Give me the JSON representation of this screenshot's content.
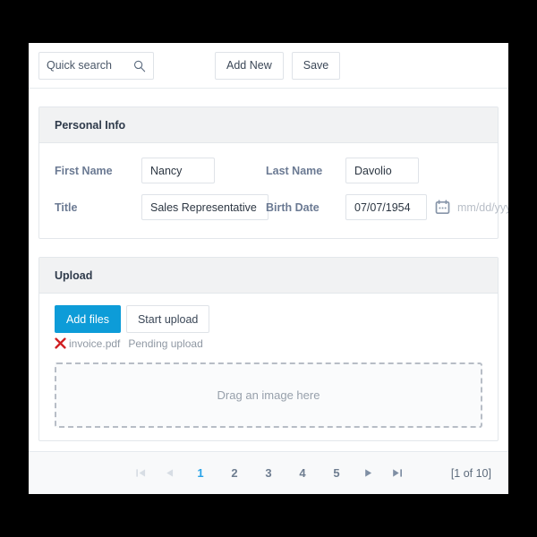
{
  "toolbar": {
    "search": {
      "value": "",
      "placeholder": "Quick search",
      "icon": "search-icon"
    },
    "buttons": [
      {
        "label": "Add New",
        "name": "add-new-button"
      },
      {
        "label": "Save",
        "name": "save-button"
      }
    ]
  },
  "personal_info": {
    "title": "Personal Info",
    "fields": {
      "first_name_label": "First Name",
      "first_name_value": "Nancy",
      "last_name_label": "Last Name",
      "last_name_value": "Davolio",
      "title_label": "Title",
      "title_value": "Sales Representative",
      "birth_date_label": "Birth Date",
      "birth_date_value": "07/07/1954",
      "birth_date_hint": "mm/dd/yyyy",
      "calendar_icon": "calendar-icon"
    }
  },
  "upload": {
    "title": "Upload",
    "add_files_label": "Add files",
    "start_upload_label": "Start upload",
    "files": [
      {
        "remove_icon": "remove-x-icon",
        "name": "invoice.pdf",
        "status": "Pending upload"
      }
    ],
    "dropzone_text": "Drag an image here"
  },
  "pagination": {
    "first_icon": "first-page-icon",
    "prev_icon": "previous-page-icon",
    "pages": [
      "1",
      "2",
      "3",
      "4",
      "5"
    ],
    "active_page": "1",
    "next_icon": "next-page-icon",
    "last_icon": "last-page-icon",
    "info": "[1 of 10]"
  },
  "colors": {
    "accent_blue": "#0d9cd8",
    "active_page_blue": "#29a3e8",
    "remove_red": "#d01f22",
    "label_gray": "#6b7a93",
    "panel_header_gray": "#f1f2f3",
    "footer_gray": "#f8f9fa"
  }
}
